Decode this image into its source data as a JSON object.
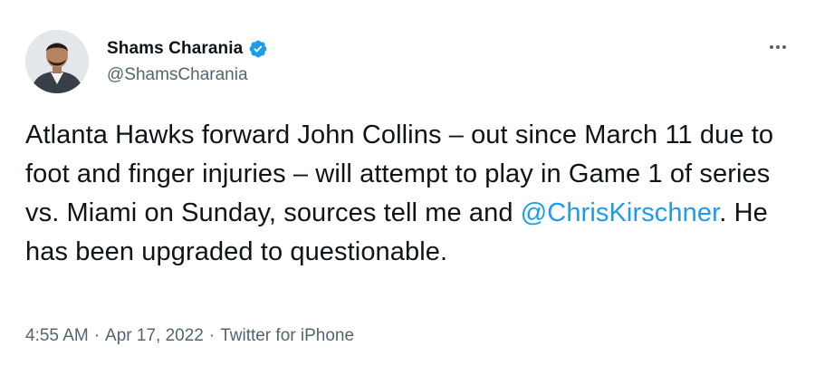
{
  "author": {
    "display_name": "Shams Charania",
    "handle": "@ShamsCharania",
    "verified": true,
    "verified_color": "#1d9bf0"
  },
  "tweet": {
    "text_before_mention": "Atlanta Hawks forward John Collins – out since March 11 due to foot and finger injuries – will attempt to play in Game 1 of series vs. Miami on Sunday, sources tell me and ",
    "mention": "@ChrisKirschner",
    "text_after_mention": ". He has been upgraded to questionable."
  },
  "meta": {
    "time": "4:55 AM",
    "separator": "·",
    "date": "Apr 17, 2022",
    "source": "Twitter for iPhone"
  },
  "icons": {
    "more": "more-options-icon",
    "verified": "verified-badge-icon"
  },
  "colors": {
    "text_primary": "#0f1419",
    "text_secondary": "#536471",
    "link": "#1d9bf0"
  }
}
